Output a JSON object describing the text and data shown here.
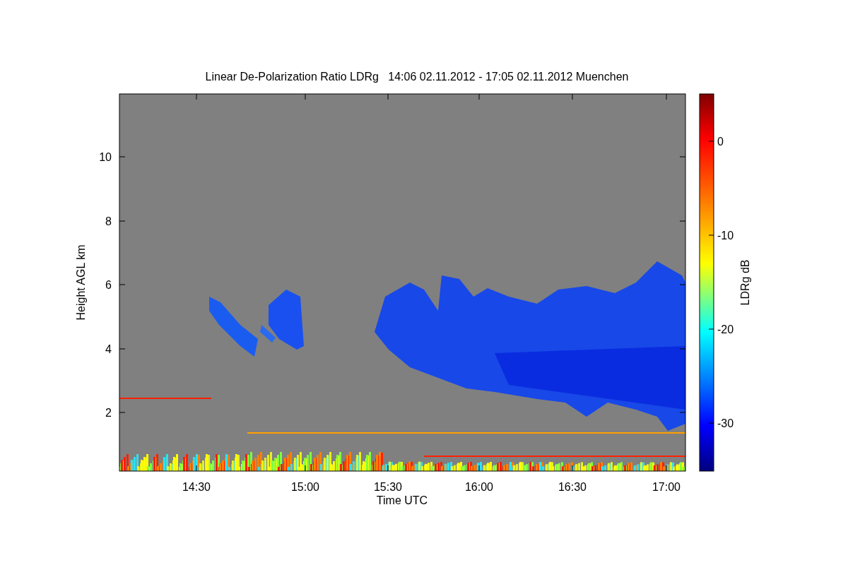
{
  "title": "Linear De-Polarization Ratio LDRg   14:06 02.11.2012 - 17:05 02.11.2012 Muenchen",
  "y_axis": {
    "label": "Height AGL km",
    "ticks": [
      "10",
      "8",
      "6",
      "4",
      "2"
    ]
  },
  "x_axis": {
    "label": "Time UTC",
    "ticks": [
      "14:30",
      "15:00",
      "15:30",
      "16:00",
      "16:30",
      "17:00"
    ]
  },
  "colorbar": {
    "label": "LDRg dB",
    "ticks": [
      "0",
      "-10",
      "-20",
      "-30"
    ]
  }
}
